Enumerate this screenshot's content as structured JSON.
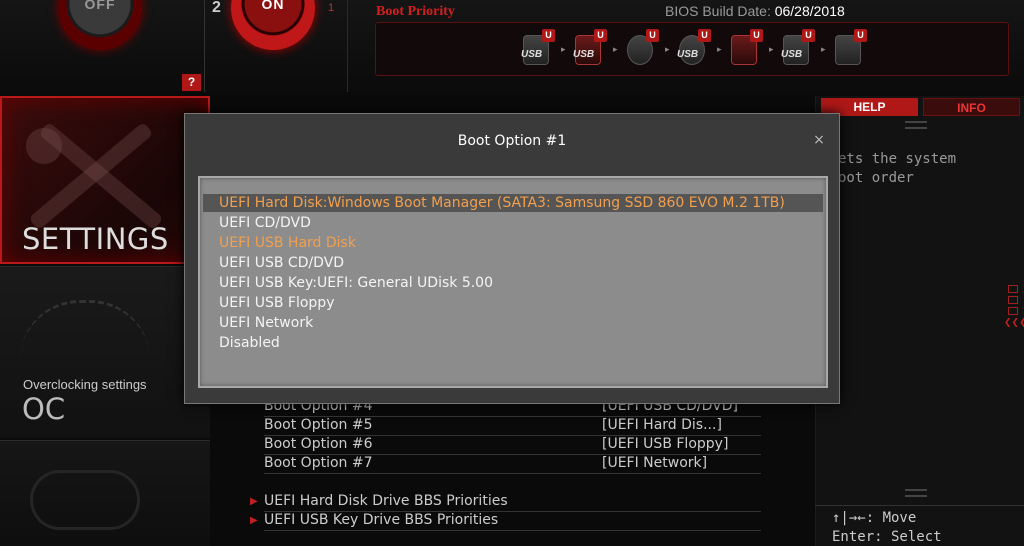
{
  "header": {
    "game_boost_state": "OFF",
    "xmp_profile_left": "2",
    "xmp_state": "ON",
    "xmp_profile_right": "1",
    "help_button": "?",
    "bios_build_label": "BIOS Build Date:",
    "bios_build_date": "06/28/2018",
    "boot_priority_label": "Boot Priority"
  },
  "boot_priority": {
    "devices": [
      {
        "icon": "usb-disk-icon",
        "tag": "USB",
        "badge": "U"
      },
      {
        "icon": "usb-key-icon",
        "tag": "USB",
        "badge": "U"
      },
      {
        "icon": "optical-disc-icon",
        "tag": "",
        "badge": "U"
      },
      {
        "icon": "usb-optical-icon",
        "tag": "USB",
        "badge": "U"
      },
      {
        "icon": "hard-disk-icon",
        "tag": "",
        "badge": "U"
      },
      {
        "icon": "usb-floppy-icon",
        "tag": "USB",
        "badge": "U"
      },
      {
        "icon": "network-icon",
        "tag": "",
        "badge": "U"
      }
    ]
  },
  "sidebar": {
    "settings_title": "SETTINGS",
    "oc_subtitle": "Overclocking settings",
    "oc_title": "OC"
  },
  "main": {
    "boot_options": [
      {
        "name": "Boot Option #4",
        "value": "[UEFI USB CD/DVD]"
      },
      {
        "name": "Boot Option #5",
        "value": "[UEFI Hard Dis...]"
      },
      {
        "name": "Boot Option #6",
        "value": "[UEFI USB Floppy]"
      },
      {
        "name": "Boot Option #7",
        "value": "[UEFI Network]"
      }
    ],
    "submenus": [
      "UEFI Hard Disk Drive BBS Priorities",
      "UEFI USB Key Drive BBS Priorities"
    ]
  },
  "help_panel": {
    "help_tab": "HELP",
    "info_tab": "INFO",
    "help_text": "ets the system\noot order",
    "key_move": "↑|→←: Move",
    "key_select": "Enter: Select"
  },
  "dialog": {
    "title": "Boot Option #1",
    "close": "×",
    "options": [
      "UEFI Hard Disk:Windows Boot Manager (SATA3: Samsung SSD 860 EVO M.2 1TB)",
      "UEFI CD/DVD",
      "UEFI USB Hard Disk",
      "UEFI USB CD/DVD",
      "UEFI USB Key:UEFI: General UDisk 5.00",
      "UEFI USB Floppy",
      "UEFI Network",
      "Disabled"
    ],
    "selected_index": 0,
    "highlighted_index": 2
  },
  "colors": {
    "accent_red": "#b01818",
    "selected_text": "#f0a050",
    "dialog_bg": "#3a3a3a",
    "list_bg": "#8c8c8c"
  }
}
